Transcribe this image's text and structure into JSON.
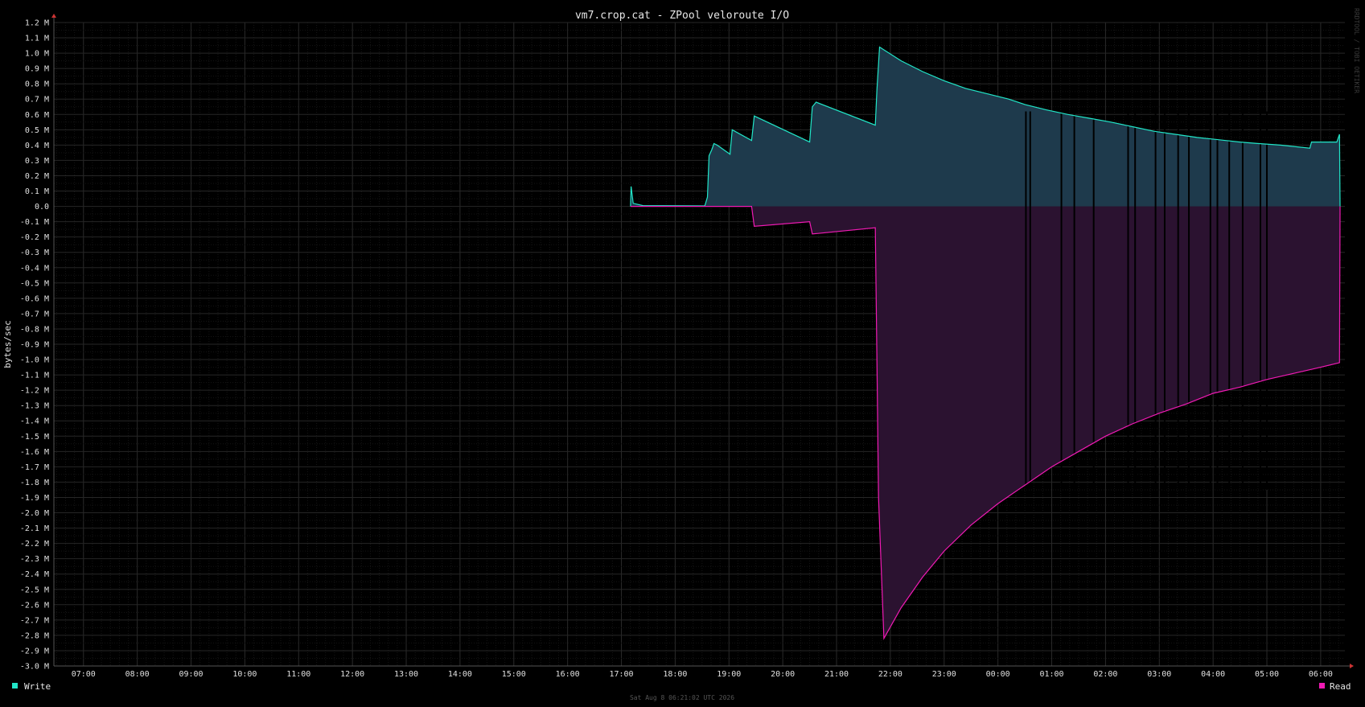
{
  "chart_data": {
    "type": "area",
    "title": "vm7.crop.cat - ZPool veloroute I/O",
    "ylabel": "bytes/sec",
    "xlabel": "",
    "ylim": [
      -3.0,
      1.2
    ],
    "y_unit": "M",
    "y_ticks": [
      "1.2 M",
      "1.1 M",
      "1.0 M",
      "0.9 M",
      "0.8 M",
      "0.7 M",
      "0.6 M",
      "0.5 M",
      "0.4 M",
      "0.3 M",
      "0.2 M",
      "0.1 M",
      "0.0",
      "-0.1 M",
      "-0.2 M",
      "-0.3 M",
      "-0.4 M",
      "-0.5 M",
      "-0.6 M",
      "-0.7 M",
      "-0.8 M",
      "-0.9 M",
      "-1.0 M",
      "-1.1 M",
      "-1.2 M",
      "-1.3 M",
      "-1.4 M",
      "-1.5 M",
      "-1.6 M",
      "-1.7 M",
      "-1.8 M",
      "-1.9 M",
      "-2.0 M",
      "-2.1 M",
      "-2.2 M",
      "-2.3 M",
      "-2.4 M",
      "-2.5 M",
      "-2.6 M",
      "-2.7 M",
      "-2.8 M",
      "-2.9 M",
      "-3.0 M"
    ],
    "x_ticks": [
      "07:00",
      "08:00",
      "09:00",
      "10:00",
      "11:00",
      "12:00",
      "13:00",
      "14:00",
      "15:00",
      "16:00",
      "17:00",
      "18:00",
      "19:00",
      "20:00",
      "21:00",
      "22:00",
      "23:00",
      "00:00",
      "01:00",
      "02:00",
      "03:00",
      "04:00",
      "05:00",
      "06:00"
    ],
    "x_range_hours": [
      6.45,
      30.45
    ],
    "grid": true,
    "legend": "bottom",
    "series": [
      {
        "name": "Write",
        "color": "#21e6c8",
        "fill": "#1e3a4c",
        "points": [
          [
            17.17,
            0.0
          ],
          [
            17.18,
            0.13
          ],
          [
            17.22,
            0.02
          ],
          [
            17.4,
            0.005
          ],
          [
            18.55,
            0.003
          ],
          [
            18.6,
            0.06
          ],
          [
            18.63,
            0.33
          ],
          [
            18.68,
            0.37
          ],
          [
            18.72,
            0.41
          ],
          [
            18.78,
            0.4
          ],
          [
            19.02,
            0.34
          ],
          [
            19.06,
            0.5
          ],
          [
            19.42,
            0.43
          ],
          [
            19.47,
            0.59
          ],
          [
            20.5,
            0.42
          ],
          [
            20.55,
            0.65
          ],
          [
            20.62,
            0.68
          ],
          [
            21.72,
            0.53
          ],
          [
            21.75,
            0.76
          ],
          [
            21.8,
            1.04
          ],
          [
            22.2,
            0.95
          ],
          [
            22.6,
            0.88
          ],
          [
            23.0,
            0.82
          ],
          [
            23.4,
            0.77
          ],
          [
            23.8,
            0.735
          ],
          [
            24.2,
            0.7
          ],
          [
            24.5,
            0.665
          ],
          [
            24.9,
            0.63
          ],
          [
            25.3,
            0.6
          ],
          [
            25.7,
            0.575
          ],
          [
            26.1,
            0.55
          ],
          [
            26.5,
            0.52
          ],
          [
            26.9,
            0.49
          ],
          [
            27.3,
            0.47
          ],
          [
            27.7,
            0.45
          ],
          [
            28.1,
            0.435
          ],
          [
            28.5,
            0.42
          ],
          [
            28.85,
            0.41
          ],
          [
            29.25,
            0.4
          ],
          [
            29.8,
            0.38
          ],
          [
            29.83,
            0.42
          ],
          [
            30.3,
            0.42
          ],
          [
            30.35,
            0.47
          ],
          [
            30.36,
            0.0
          ]
        ]
      },
      {
        "name": "Read",
        "color": "#f01ab4",
        "fill": "#2b1230",
        "points": [
          [
            17.17,
            0.0
          ],
          [
            19.42,
            0.0
          ],
          [
            19.47,
            -0.13
          ],
          [
            20.5,
            -0.1
          ],
          [
            20.55,
            -0.18
          ],
          [
            21.72,
            -0.14
          ],
          [
            21.75,
            -1.0
          ],
          [
            21.78,
            -1.9
          ],
          [
            21.88,
            -2.82
          ],
          [
            22.2,
            -2.62
          ],
          [
            22.6,
            -2.42
          ],
          [
            23.0,
            -2.25
          ],
          [
            23.5,
            -2.08
          ],
          [
            24.0,
            -1.94
          ],
          [
            24.5,
            -1.82
          ],
          [
            25.0,
            -1.7
          ],
          [
            25.5,
            -1.6
          ],
          [
            26.0,
            -1.5
          ],
          [
            26.5,
            -1.42
          ],
          [
            27.0,
            -1.35
          ],
          [
            27.5,
            -1.29
          ],
          [
            28.0,
            -1.22
          ],
          [
            28.5,
            -1.18
          ],
          [
            29.0,
            -1.13
          ],
          [
            29.5,
            -1.09
          ],
          [
            30.0,
            -1.05
          ],
          [
            30.35,
            -1.02
          ],
          [
            30.36,
            0.0
          ]
        ]
      }
    ],
    "gaps_hours": [
      24.52,
      24.6,
      25.18,
      25.42,
      25.78,
      26.42,
      26.55,
      26.93,
      27.1,
      27.35,
      27.55,
      27.95,
      28.08,
      28.3,
      28.55,
      28.88,
      29.0
    ]
  },
  "footer": "Sat Aug  8 06:21:02 UTC 2026",
  "watermark": "RRDTOOL / TOBI OETIKER"
}
